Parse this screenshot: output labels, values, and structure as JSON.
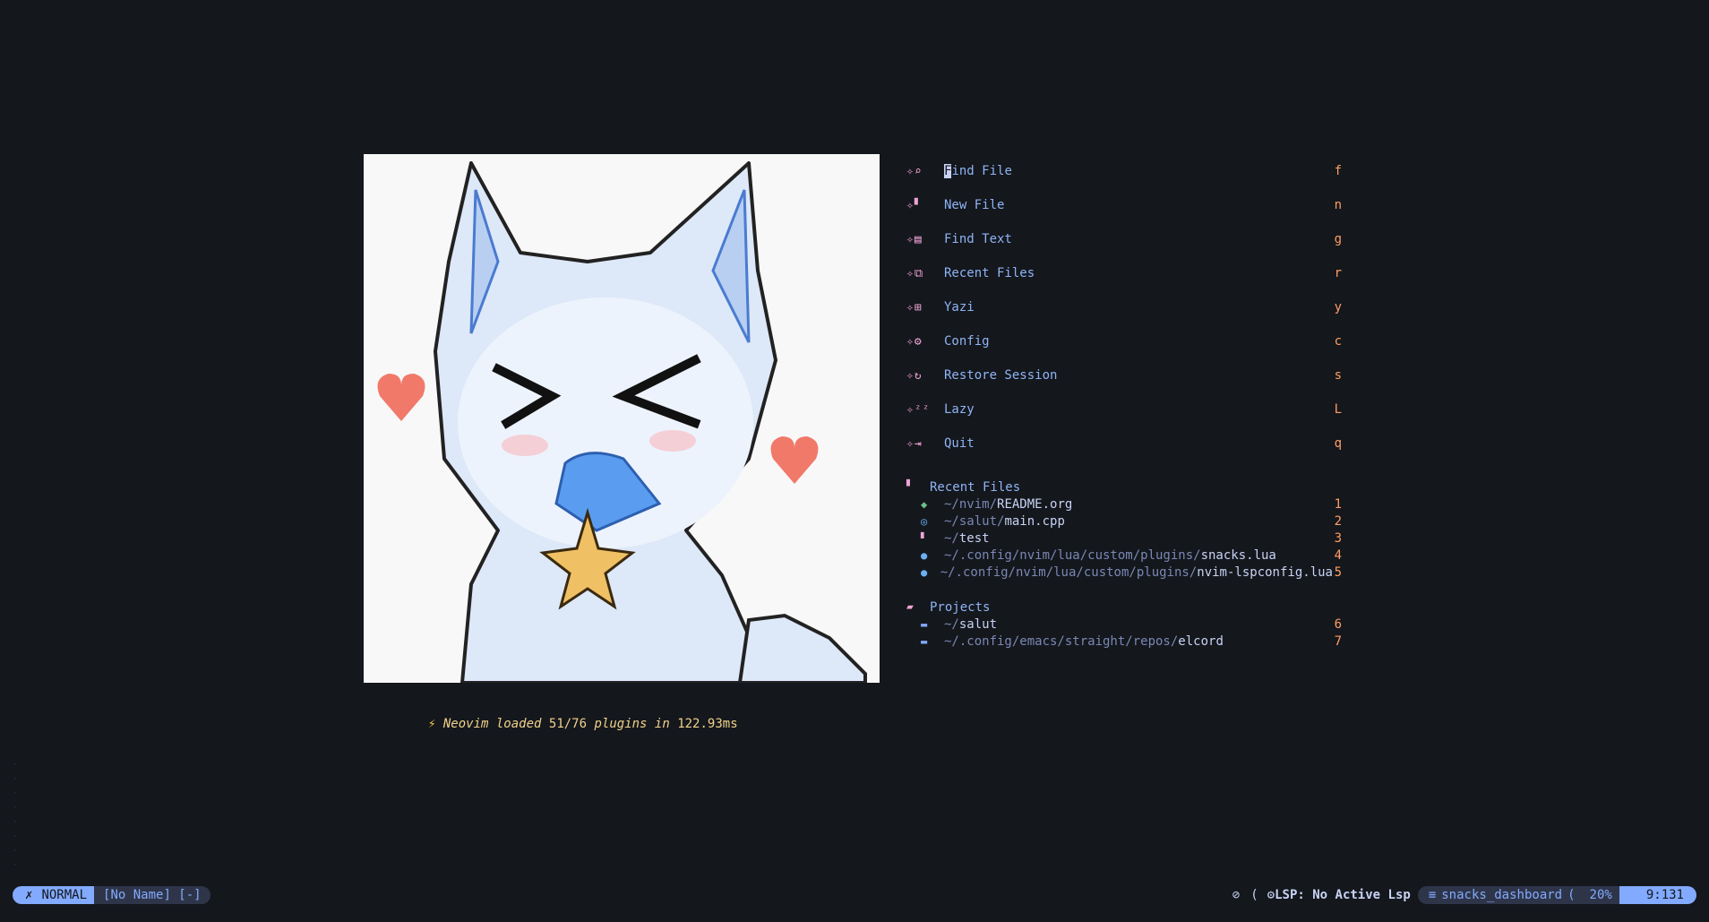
{
  "dashboard": {
    "menu": [
      {
        "icon": "search-icon",
        "glyph": "⌕",
        "label": "Find File",
        "key": "f"
      },
      {
        "icon": "file-icon",
        "glyph": "▘",
        "label": "New File",
        "key": "n"
      },
      {
        "icon": "text-search-icon",
        "glyph": "▤",
        "label": "Find Text",
        "key": "g"
      },
      {
        "icon": "recent-files-icon",
        "glyph": "⧉",
        "label": "Recent Files",
        "key": "r"
      },
      {
        "icon": "tree-icon",
        "glyph": "⊞",
        "label": "Yazi",
        "key": "y"
      },
      {
        "icon": "gear-icon",
        "glyph": "⚙",
        "label": "Config",
        "key": "c"
      },
      {
        "icon": "restore-icon",
        "glyph": "↻",
        "label": "Restore Session",
        "key": "s"
      },
      {
        "icon": "sleep-icon",
        "glyph": "ᶻᶻ",
        "label": "Lazy",
        "key": "L"
      },
      {
        "icon": "quit-icon",
        "glyph": "⇥",
        "label": "Quit",
        "key": "q"
      }
    ],
    "recent": {
      "title": "Recent Files",
      "items": [
        {
          "icon": "org-icon",
          "color": "#6cc08a",
          "dir": "~/nvim/",
          "name": "README.org",
          "key": "1"
        },
        {
          "icon": "cpp-icon",
          "color": "#6ab0f3",
          "dir": "~/salut/",
          "name": "main.cpp",
          "key": "2"
        },
        {
          "icon": "file-icon",
          "color": "#f0a3d6",
          "dir": "~/",
          "name": "test",
          "key": "3"
        },
        {
          "icon": "lua-icon",
          "color": "#6ab0f3",
          "dir": "~/.config/nvim/lua/custom/plugins/",
          "name": "snacks.lua",
          "key": "4"
        },
        {
          "icon": "lua-icon",
          "color": "#6ab0f3",
          "dir": "~/.config/nvim/lua/custom/plugins/",
          "name": "nvim-lspconfig.lua",
          "key": "5"
        }
      ]
    },
    "projects": {
      "title": "Projects",
      "items": [
        {
          "dir": "~/",
          "name": "salut",
          "key": "6"
        },
        {
          "dir": "~/.config/emacs/straight/repos/",
          "name": "elcord",
          "key": "7"
        }
      ]
    },
    "startup": {
      "prefix": "Neovim loaded ",
      "count": "51/76",
      "middle": " plugins in ",
      "time": "122.93ms"
    }
  },
  "statusline": {
    "mode": "NORMAL",
    "buffer": "[No Name] [-]",
    "diag_icon": "no-diagnostics-icon",
    "lsp": "LSP: No Active Lsp",
    "filetype": "snacks_dashboard",
    "percent": "20%",
    "position": "9:131"
  },
  "colors": {
    "background": "#14171c",
    "accent": "#82aaff",
    "key": "#ff9e64",
    "icon": "#f0a3d6"
  }
}
